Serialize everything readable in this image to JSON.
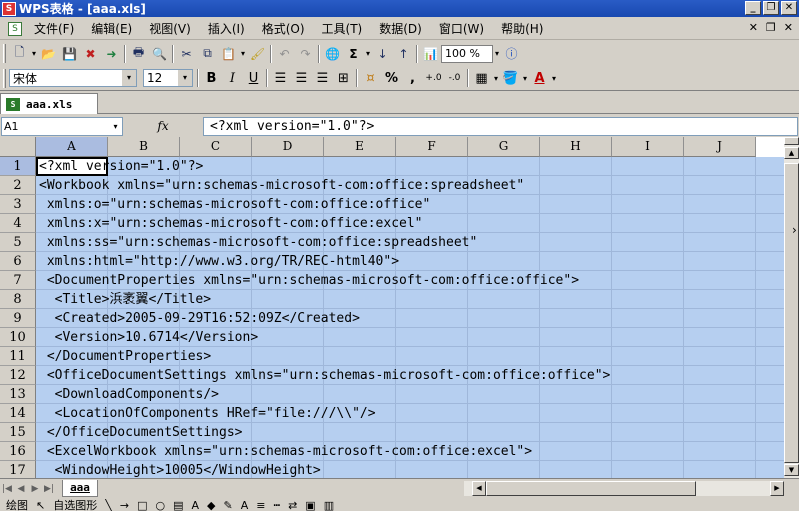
{
  "window": {
    "title": "WPS表格 - [aaa.xls]",
    "buttons": [
      "_",
      "❐",
      "✕"
    ]
  },
  "menu": {
    "items": [
      "文件(F)",
      "编辑(E)",
      "视图(V)",
      "插入(I)",
      "格式(O)",
      "工具(T)",
      "数据(D)",
      "窗口(W)",
      "帮助(H)"
    ],
    "controls": [
      "✕",
      "❐",
      "✕"
    ]
  },
  "toolbar": {
    "zoom": "100 %"
  },
  "format": {
    "font": "宋体",
    "size": "12",
    "bold": "B",
    "italic": "I",
    "underline": "U",
    "percent": "%",
    "comma": ","
  },
  "doc_tab": {
    "label": "aaa.xls"
  },
  "formula_bar": {
    "cell_ref": "A1",
    "fx": "fx",
    "formula": "<?xml version=\"1.0\"?>"
  },
  "columns": [
    "A",
    "B",
    "C",
    "D",
    "E",
    "F",
    "G",
    "H",
    "I",
    "J"
  ],
  "rows": [
    {
      "n": "1",
      "text": "<?xml version=\"1.0\"?>"
    },
    {
      "n": "2",
      "text": "<Workbook xmlns=\"urn:schemas-microsoft-com:office:spreadsheet\""
    },
    {
      "n": "3",
      "text": " xmlns:o=\"urn:schemas-microsoft-com:office:office\""
    },
    {
      "n": "4",
      "text": " xmlns:x=\"urn:schemas-microsoft-com:office:excel\""
    },
    {
      "n": "5",
      "text": " xmlns:ss=\"urn:schemas-microsoft-com:office:spreadsheet\""
    },
    {
      "n": "6",
      "text": " xmlns:html=\"http://www.w3.org/TR/REC-html40\">"
    },
    {
      "n": "7",
      "text": " <DocumentProperties xmlns=\"urn:schemas-microsoft-com:office:office\">"
    },
    {
      "n": "8",
      "text": "  <Title>浜袤翼</Title>"
    },
    {
      "n": "9",
      "text": "  <Created>2005-09-29T16:52:09Z</Created>"
    },
    {
      "n": "10",
      "text": "  <Version>10.6714</Version>"
    },
    {
      "n": "11",
      "text": " </DocumentProperties>"
    },
    {
      "n": "12",
      "text": " <OfficeDocumentSettings xmlns=\"urn:schemas-microsoft-com:office:office\">"
    },
    {
      "n": "13",
      "text": "  <DownloadComponents/>"
    },
    {
      "n": "14",
      "text": "  <LocationOfComponents HRef=\"file:///\\\\\"/>"
    },
    {
      "n": "15",
      "text": " </OfficeDocumentSettings>"
    },
    {
      "n": "16",
      "text": " <ExcelWorkbook xmlns=\"urn:schemas-microsoft-com:office:excel\">"
    },
    {
      "n": "17",
      "text": "  <WindowHeight>10005</WindowHeight>"
    }
  ],
  "sheet_tabs": [
    "aaa"
  ],
  "draw_toolbar": {
    "draw": "绘图",
    "autoshapes": "自选图形"
  },
  "colors": {
    "selection": "#b6cff0",
    "titlebar": "#2a5cc6",
    "chrome": "#d4d0c8"
  }
}
